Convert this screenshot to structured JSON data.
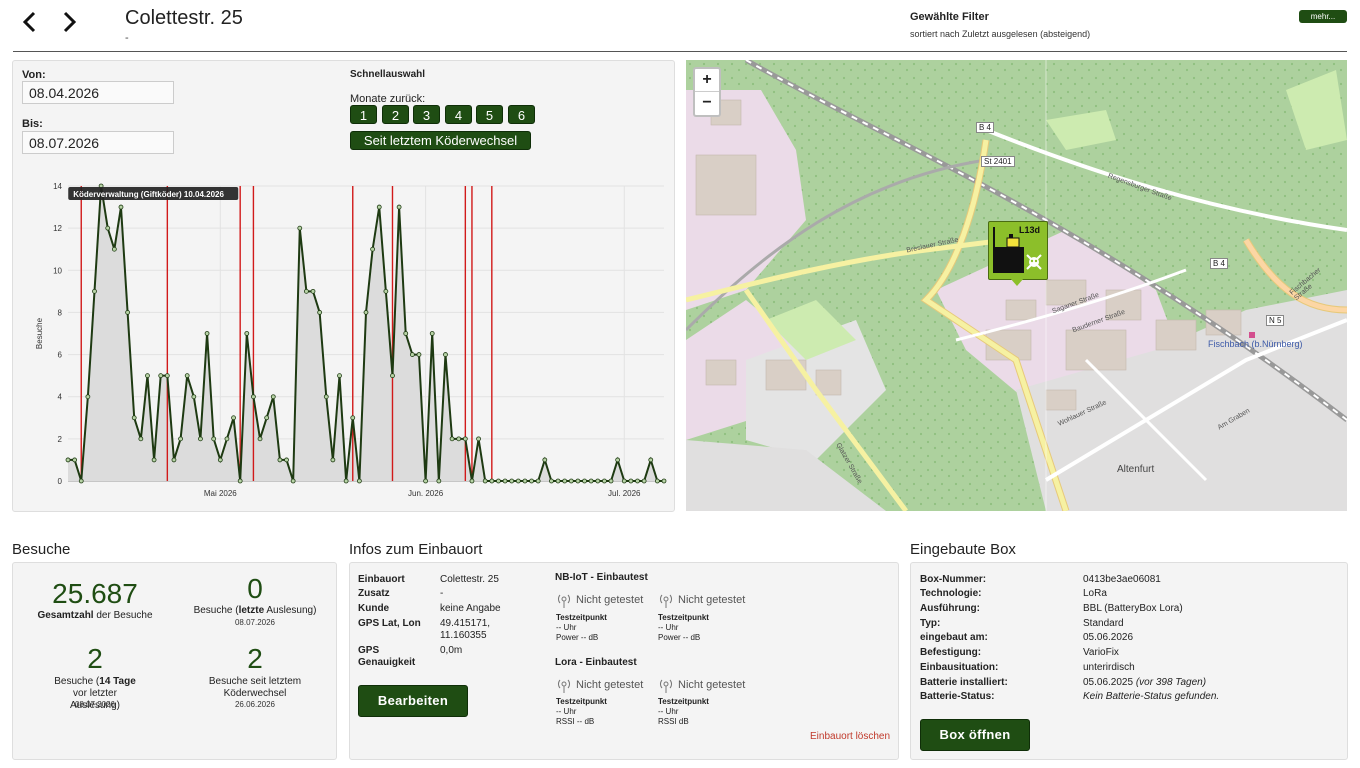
{
  "header": {
    "title": "Colettestr. 25",
    "subtitle": "-",
    "filter_title": "Gewählte Filter",
    "filter_sub": "sortiert nach Zuletzt ausgelesen (absteigend)",
    "more_label": "mehr..."
  },
  "daterange": {
    "from_label": "Von:",
    "from_value": "08.04.2026",
    "to_label": "Bis:",
    "to_value": "08.07.2026",
    "quick_title": "Schnellauswahl",
    "months_label": "Monate zurück:",
    "months": [
      "1",
      "2",
      "3",
      "4",
      "5",
      "6"
    ],
    "since_label": "Seit letztem Köderwechsel"
  },
  "chart_data": {
    "type": "area",
    "ylabel": "Besuche",
    "ylim": [
      0,
      14
    ],
    "yticks": [
      "0",
      "2",
      "4",
      "6",
      "8",
      "10",
      "12",
      "14"
    ],
    "xticks": [
      {
        "label": "Mai 2026",
        "day": 23
      },
      {
        "label": "Jun. 2026",
        "day": 54
      },
      {
        "label": "Jul. 2026",
        "day": 84
      }
    ],
    "x_days": 91,
    "values": [
      1,
      1,
      0,
      4,
      9,
      14,
      12,
      11,
      13,
      8,
      3,
      2,
      5,
      1,
      5,
      5,
      1,
      2,
      5,
      4,
      2,
      7,
      2,
      1,
      2,
      3,
      0,
      7,
      4,
      2,
      3,
      4,
      1,
      1,
      0,
      12,
      9,
      9,
      8,
      4,
      1,
      5,
      0,
      3,
      0,
      8,
      11,
      13,
      9,
      5,
      13,
      7,
      6,
      6,
      0,
      7,
      0,
      6,
      2,
      2,
      2,
      0,
      2,
      0,
      0,
      0,
      0,
      0,
      0,
      0,
      0,
      0,
      1,
      0,
      0,
      0,
      0,
      0,
      0,
      0,
      0,
      0,
      0,
      1,
      0,
      0,
      0,
      0,
      1,
      0,
      0
    ],
    "event_days": [
      2,
      15,
      26,
      28,
      43,
      49,
      60,
      61,
      64
    ],
    "tooltip": "Köderverwaltung (Giftköder) 10.04.2026"
  },
  "map": {
    "zoom_in": "+",
    "zoom_out": "−",
    "marker_label": "L13d",
    "places": [
      "Fischbach (b.Nürnberg)",
      "Altenfurt"
    ],
    "roads": [
      "B 4",
      "St 2401",
      "B 4",
      "N 5",
      "Regensburger Straße",
      "Breslauer Straße",
      "Saganer Straße",
      "Bauderner Straße",
      "Wohlauer Straße",
      "Glatzer Straße",
      "Am Graben",
      "Fischbacher Straße"
    ]
  },
  "visits": {
    "section_title": "Besuche",
    "total_value": "25.687",
    "total_label_bold": "Gesamtzahl",
    "total_label_rest": " der Besuche",
    "last_value": "0",
    "last_label_pre": "Besuche (",
    "last_label_bold": "letzte",
    "last_label_post": " Auslesung)",
    "last_date": "08.07.2026",
    "days14_value": "2",
    "days14_label_pre": "Besuche (",
    "days14_label_bold": "14 Tage",
    "days14_label_post": " vor letzter Auslesung)",
    "days14_date": "08.07.2026",
    "since_value": "2",
    "since_label": "Besuche seit letztem Köderwechsel",
    "since_date": "26.06.2026"
  },
  "location": {
    "section_title": "Infos zum Einbauort",
    "rows": [
      {
        "key": "Einbauort",
        "value": "Colettestr. 25"
      },
      {
        "key": "Zusatz",
        "value": "-"
      },
      {
        "key": "Kunde",
        "value": "keine Angabe"
      },
      {
        "key": "GPS Lat, Lon",
        "value": "49.415171, 11.160355"
      },
      {
        "key": "GPS Genauigkeit",
        "value": "0,0m"
      }
    ],
    "edit_label": "Bearbeiten",
    "nbiot_title": "NB-IoT - Einbautest",
    "lora_title": "Lora - Einbautest",
    "not_tested": "Nicht getestet",
    "test_time_label": "Testzeitpunkt",
    "time_val": "-- Uhr",
    "power_val": "Power -- dB",
    "rssi1_val": "RSSI -- dB",
    "rssi2_val": "RSSI dB",
    "delete_label": "Einbauort löschen"
  },
  "box": {
    "section_title": "Eingebaute Box",
    "rows": [
      {
        "key": "Box-Nummer:",
        "value": "0413be3ae06081"
      },
      {
        "key": "Technologie:",
        "value": "LoRa"
      },
      {
        "key": "Ausführung:",
        "value": "BBL (BatteryBox Lora)"
      },
      {
        "key": "Typ:",
        "value": "Standard"
      },
      {
        "key": "eingebaut am:",
        "value": "05.06.2026"
      },
      {
        "key": "Befestigung:",
        "value": "VarioFix"
      },
      {
        "key": "Einbausituation:",
        "value": "unterirdisch"
      },
      {
        "key": "Batterie installiert:",
        "value": "05.06.2025",
        "note": "(vor 398 Tagen)"
      },
      {
        "key": "Batterie-Status:",
        "value": "Kein Batterie-Status gefunden."
      }
    ],
    "open_label": "Box öffnen"
  },
  "colors": {
    "accent": "#1f4d13",
    "event_line": "#d11a1a",
    "danger": "#c0392b"
  }
}
